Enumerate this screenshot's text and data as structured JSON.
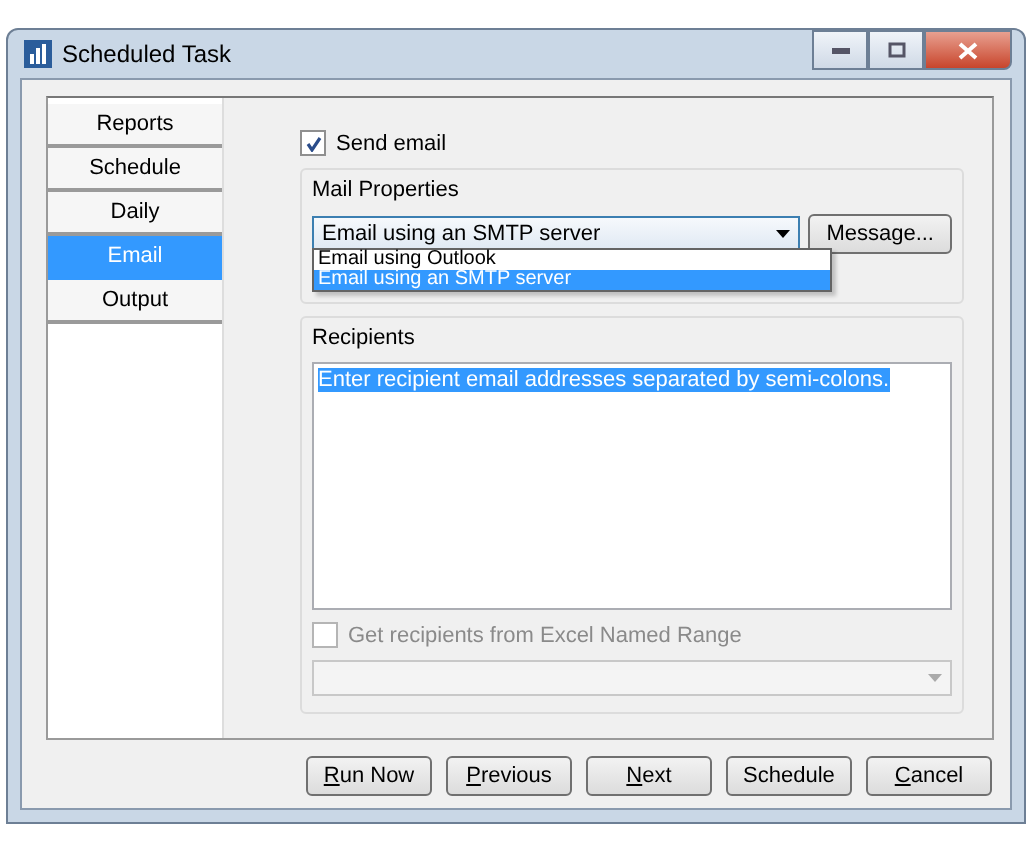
{
  "window": {
    "title": "Scheduled Task"
  },
  "tabs": [
    {
      "label": "Reports",
      "selected": false
    },
    {
      "label": "Schedule",
      "selected": false
    },
    {
      "label": "Daily",
      "selected": false
    },
    {
      "label": "Email",
      "selected": true
    },
    {
      "label": "Output",
      "selected": false
    }
  ],
  "send_email": {
    "label": "Send email",
    "checked": true
  },
  "mail_properties": {
    "title": "Mail Properties",
    "method": "Email using an SMTP server",
    "expanded": true,
    "options": [
      {
        "label": "Email using Outlook",
        "selected": false
      },
      {
        "label": "Email using an SMTP server",
        "selected": true
      }
    ],
    "message_button": "Message..."
  },
  "recipients": {
    "title": "Recipients",
    "text": "Enter recipient email addresses separated by semi-colons.",
    "named_range": {
      "label": "Get recipients from Excel Named Range",
      "checked": false
    }
  },
  "buttons": [
    {
      "label": "Run Now",
      "underline_first": true
    },
    {
      "label": "Previous",
      "underline_first": true
    },
    {
      "label": "Next",
      "underline_first": true
    },
    {
      "label": "Schedule",
      "underline_first": false
    },
    {
      "label": "Cancel",
      "underline_first": true
    }
  ]
}
